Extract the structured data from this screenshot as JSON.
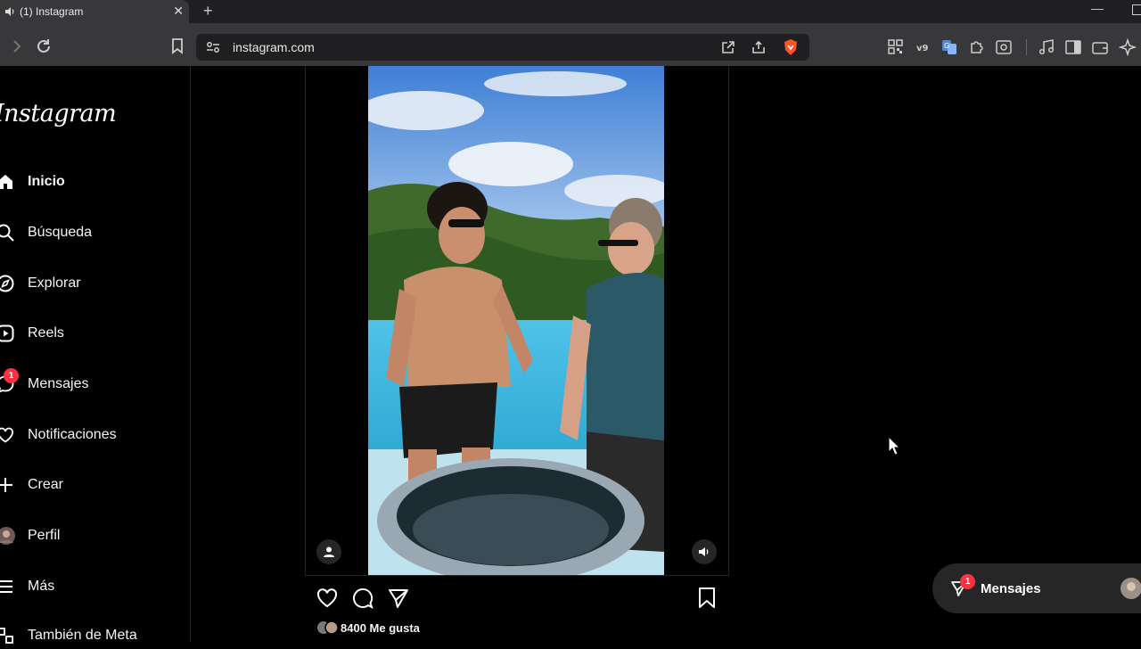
{
  "browser": {
    "tab_title": "(1) Instagram",
    "tab_close": "✕",
    "new_tab": "+",
    "url": "instagram.com"
  },
  "sidebar": {
    "logo": "Instagram",
    "items": [
      {
        "label": "Inicio",
        "icon": "home-icon",
        "active": true
      },
      {
        "label": "Búsqueda",
        "icon": "search-icon"
      },
      {
        "label": "Explorar",
        "icon": "compass-icon"
      },
      {
        "label": "Reels",
        "icon": "reels-icon"
      },
      {
        "label": "Mensajes",
        "icon": "messenger-icon",
        "badge": "1"
      },
      {
        "label": "Notificaciones",
        "icon": "heart-icon"
      },
      {
        "label": "Crear",
        "icon": "plus-icon"
      },
      {
        "label": "Perfil",
        "icon": "avatar"
      },
      {
        "label": "Más",
        "icon": "menu-icon"
      },
      {
        "label": "También de Meta",
        "icon": "meta-apps-icon"
      }
    ]
  },
  "post": {
    "likes": "8400 Me gusta"
  },
  "messages_pill": {
    "label": "Mensajes",
    "badge": "1"
  },
  "colors": {
    "background": "#000000",
    "chrome": "#38383b",
    "badge": "#ff3040"
  }
}
